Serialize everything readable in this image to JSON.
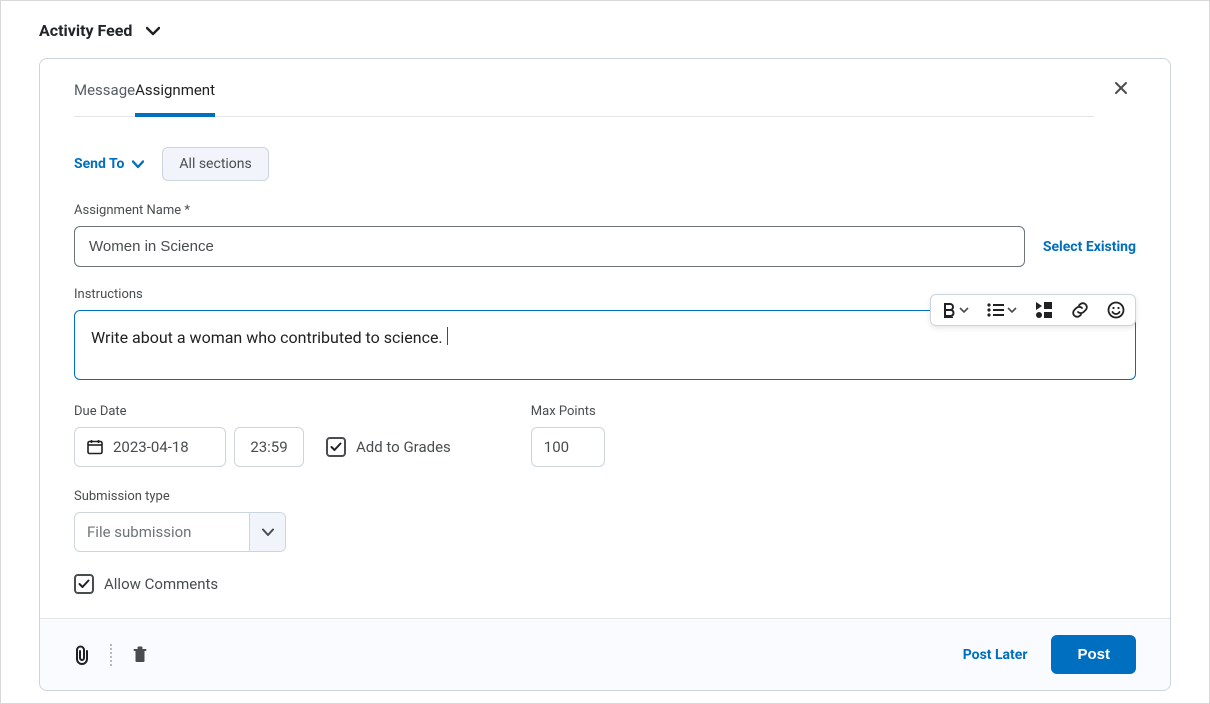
{
  "header": {
    "title": "Activity Feed"
  },
  "tabs": [
    {
      "label": "Message",
      "active": false
    },
    {
      "label": "Assignment",
      "active": true
    }
  ],
  "sendto": {
    "label": "Send To",
    "chip": "All sections"
  },
  "assignment_name": {
    "label": "Assignment Name *",
    "value": "Women in Science",
    "select_existing": "Select Existing"
  },
  "instructions": {
    "label": "Instructions",
    "value": "Write about a woman who contributed to science."
  },
  "due_date": {
    "label": "Due Date",
    "date": "2023-04-18",
    "time": "23:59"
  },
  "add_to_grades": {
    "label": "Add to Grades",
    "checked": true
  },
  "max_points": {
    "label": "Max Points",
    "value": "100"
  },
  "submission_type": {
    "label": "Submission type",
    "value": "File submission"
  },
  "allow_comments": {
    "label": "Allow Comments",
    "checked": true
  },
  "footer": {
    "post_later": "Post Later",
    "post": "Post"
  },
  "icons": {
    "bold": "bold-icon",
    "list": "list-icon",
    "media": "insert-stuff-icon",
    "link": "link-icon",
    "emoji": "emoji-icon",
    "attach": "attach-icon",
    "trash": "trash-icon",
    "calendar": "calendar-icon"
  }
}
